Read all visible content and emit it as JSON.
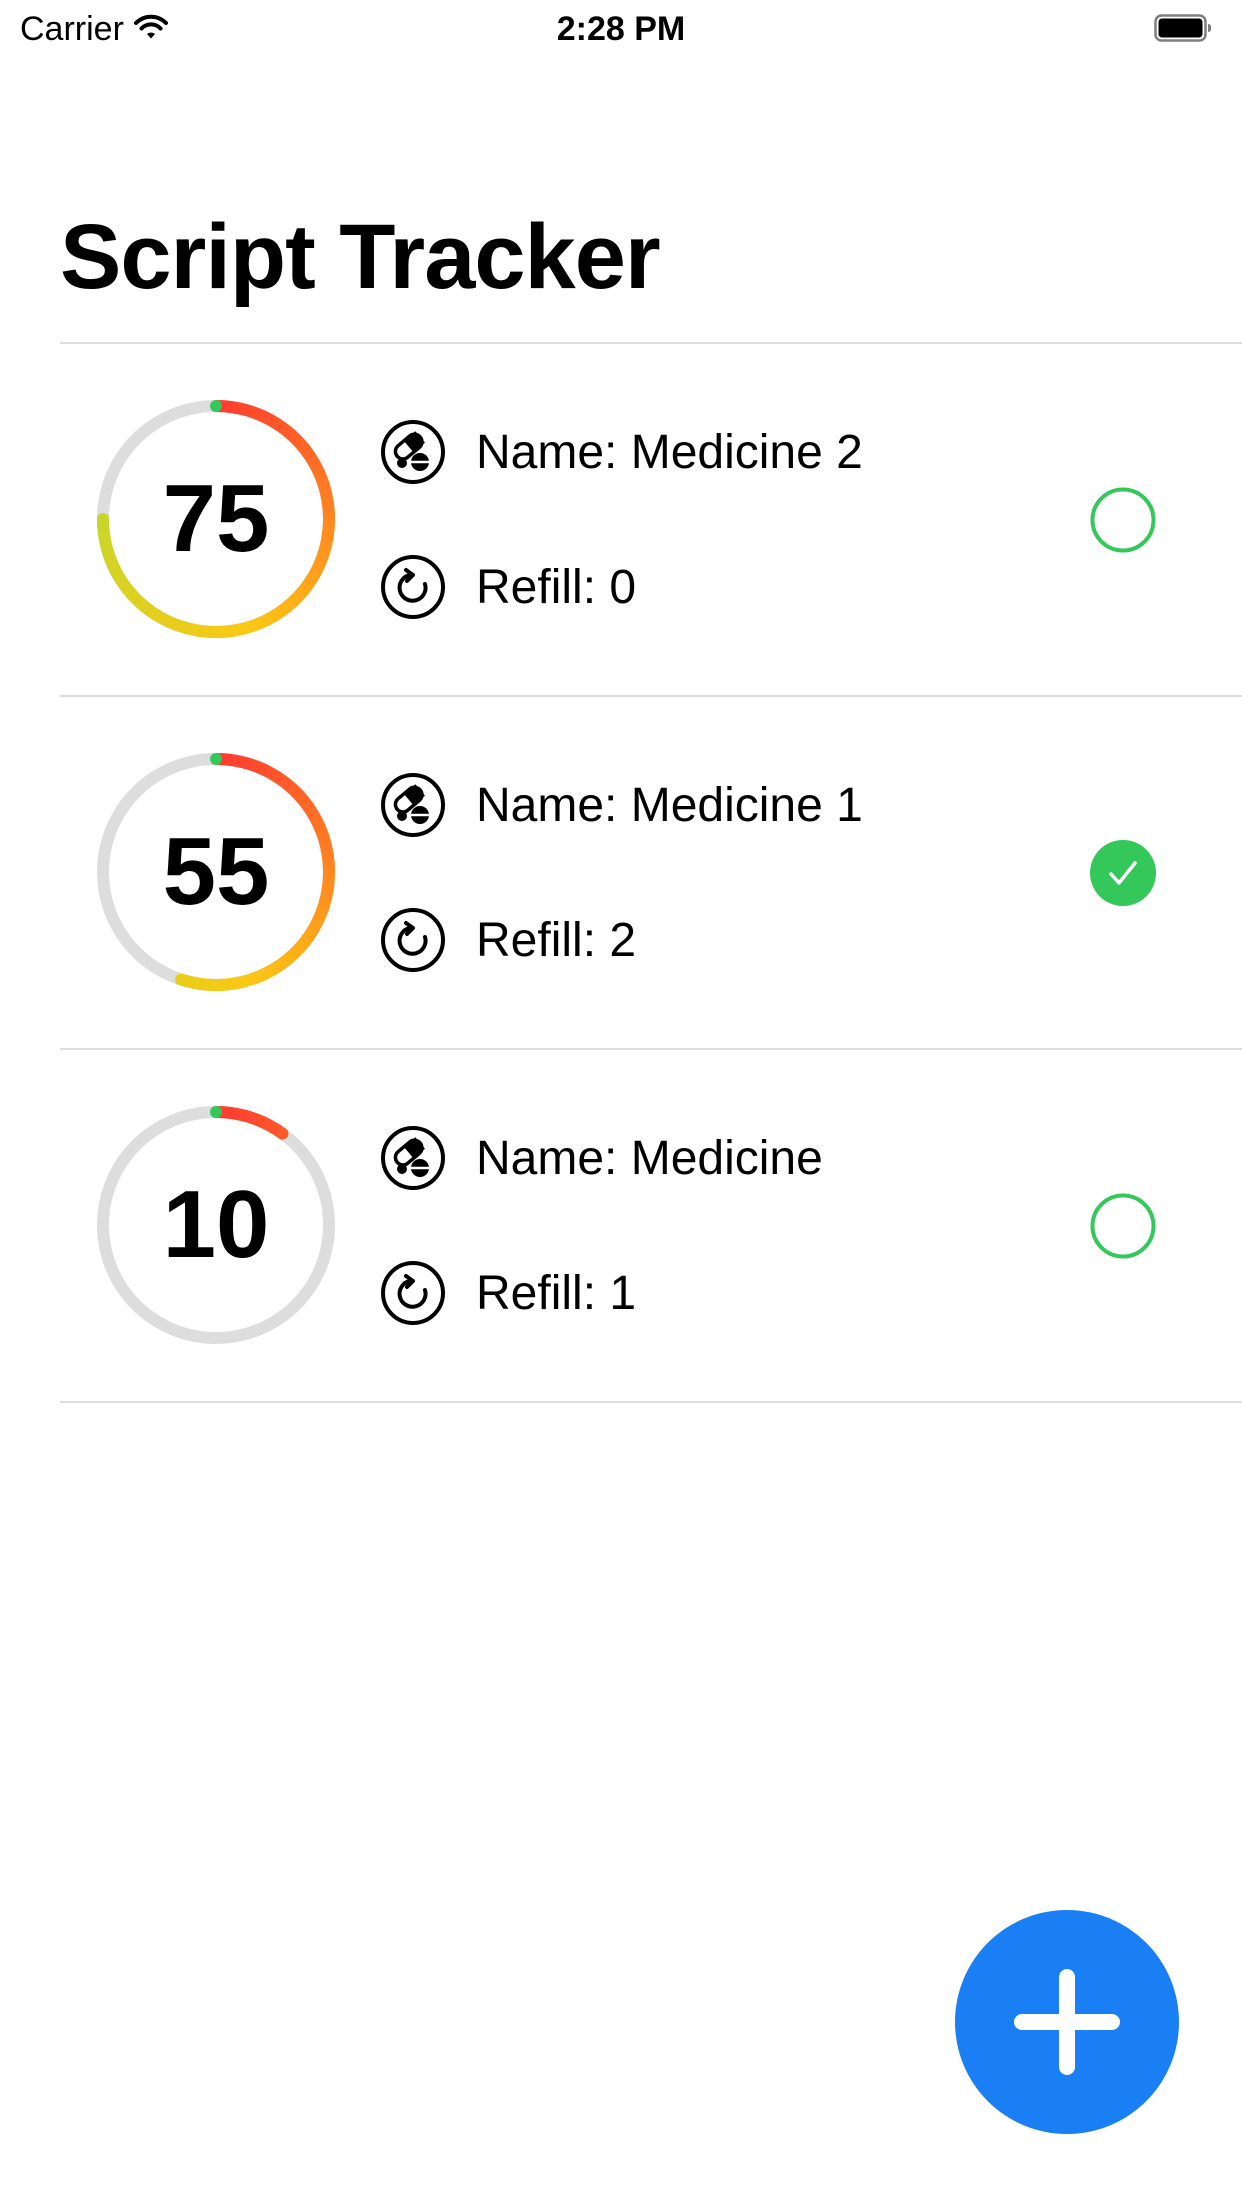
{
  "status_bar": {
    "carrier": "Carrier",
    "time": "2:28 PM"
  },
  "page_title": "Script Tracker",
  "colors": {
    "ring_track": "#dddddd",
    "ring_start": "#ff3b30",
    "ring_end": "#c8d62a",
    "ring_cap": "#34c759",
    "check_green": "#34c759",
    "fab_blue": "#1a7ff5"
  },
  "prescriptions": [
    {
      "progress": 75,
      "progress_label": "75",
      "name_text": "Name: Medicine 2",
      "refill_text": "Refill: 0",
      "checked": false
    },
    {
      "progress": 55,
      "progress_label": "55",
      "name_text": "Name: Medicine 1",
      "refill_text": "Refill: 2",
      "checked": true
    },
    {
      "progress": 10,
      "progress_label": "10",
      "name_text": "Name: Medicine",
      "refill_text": "Refill: 1",
      "checked": false
    }
  ],
  "icons": {
    "name": "pills-icon",
    "refill": "refill-icon",
    "add": "plus-icon"
  }
}
